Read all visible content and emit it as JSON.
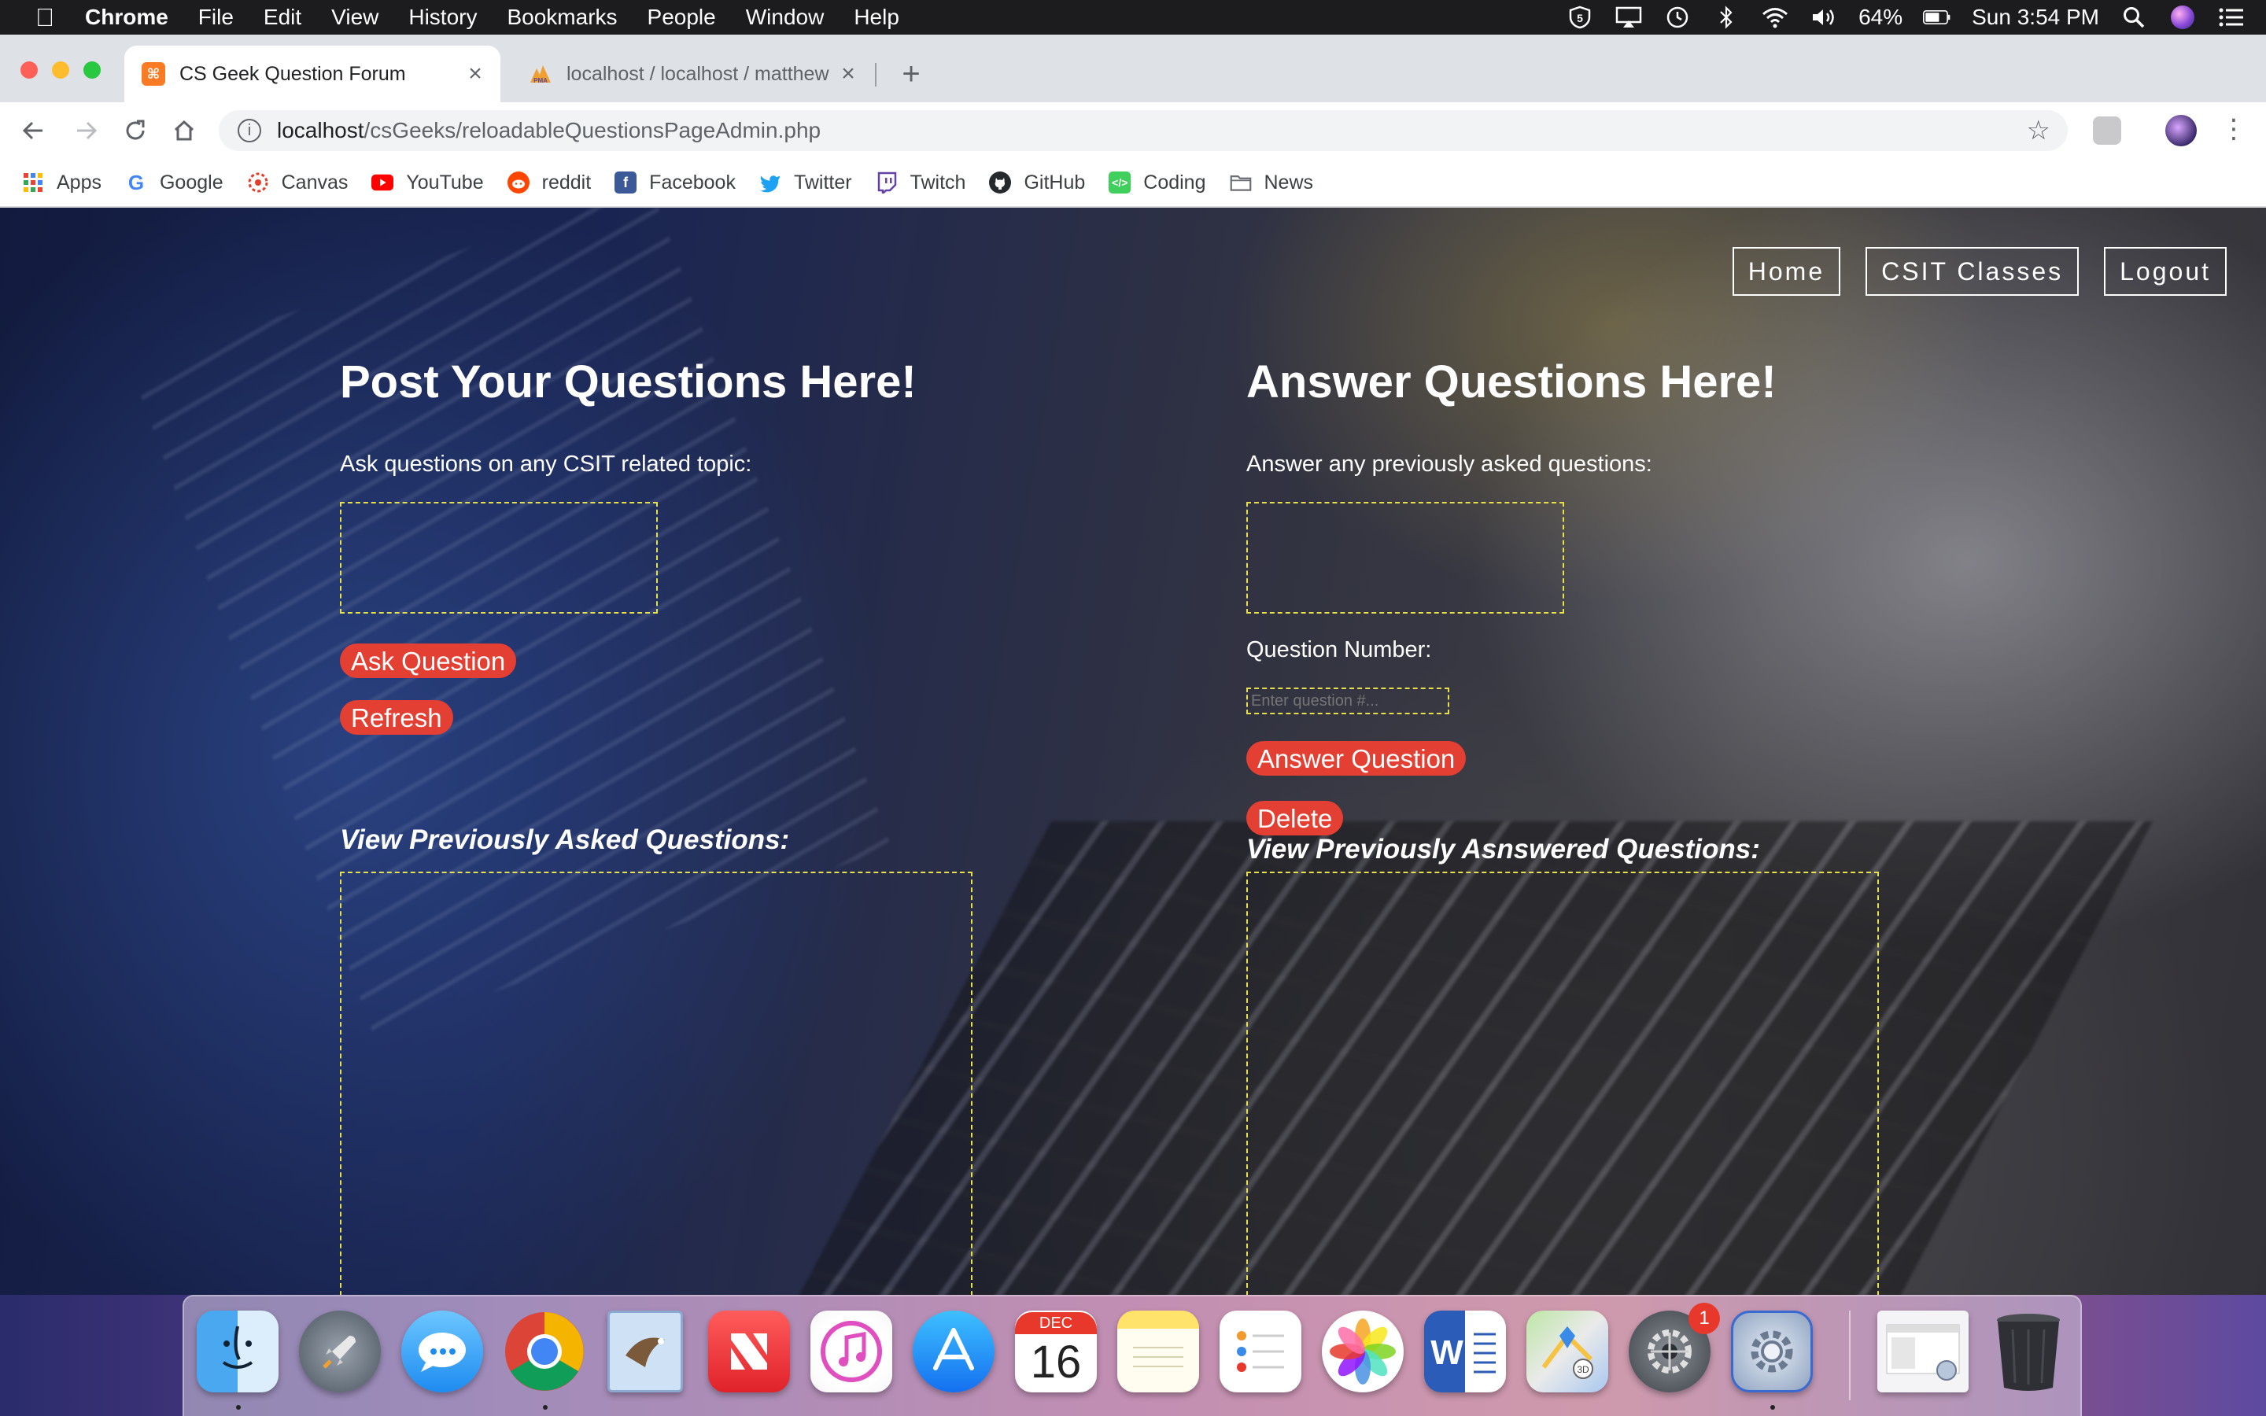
{
  "menubar": {
    "app": "Chrome",
    "items": [
      "File",
      "Edit",
      "View",
      "History",
      "Bookmarks",
      "People",
      "Window",
      "Help"
    ],
    "battery": "64%",
    "clock": "Sun 3:54 PM"
  },
  "tabs": [
    {
      "title": "CS Geek Question Forum",
      "favicon": "xampp-icon"
    },
    {
      "title": "localhost / localhost / matthew",
      "favicon": "phpmyadmin-icon"
    }
  ],
  "address": {
    "host": "localhost",
    "path": "/csGeeks/reloadableQuestionsPageAdmin.php"
  },
  "bookmarks": [
    {
      "label": "Apps",
      "icon": "apps-grid-icon",
      "color": "#4285f4"
    },
    {
      "label": "Google",
      "icon": "google-icon",
      "color": "#ffffff"
    },
    {
      "label": "Canvas",
      "icon": "canvas-icon",
      "color": "#e13f2b"
    },
    {
      "label": "YouTube",
      "icon": "youtube-icon",
      "color": "#ff0000"
    },
    {
      "label": "reddit",
      "icon": "reddit-icon",
      "color": "#ff4500"
    },
    {
      "label": "Facebook",
      "icon": "facebook-icon",
      "color": "#3b5998"
    },
    {
      "label": "Twitter",
      "icon": "twitter-icon",
      "color": "#1da1f2"
    },
    {
      "label": "Twitch",
      "icon": "twitch-icon",
      "color": "#6441a5"
    },
    {
      "label": "GitHub",
      "icon": "github-icon",
      "color": "#24292e"
    },
    {
      "label": "Coding",
      "icon": "coding-icon",
      "color": "#3ecf5c"
    },
    {
      "label": "News",
      "icon": "folder-icon",
      "color": "#6b6f75"
    }
  ],
  "nav": {
    "home": "Home",
    "classes": "CSIT Classes",
    "logout": "Logout"
  },
  "ask": {
    "heading": "Post Your Questions Here!",
    "subtitle": "Ask questions on any CSIT related topic:",
    "ask_button": "Ask Question",
    "refresh_button": "Refresh",
    "view_heading": "View Previously Asked Questions:"
  },
  "answer": {
    "heading": "Answer Questions Here!",
    "subtitle": "Answer any previously asked questions:",
    "question_number_label": "Question Number:",
    "question_number_placeholder": "Enter question #...",
    "answer_button": "Answer Question",
    "delete_button": "Delete",
    "view_heading": "View Previously Asnswered Questions:"
  },
  "dock": {
    "calendar_month": "DEC",
    "calendar_day": "16",
    "badge_count": "1"
  },
  "colors": {
    "accent_button": "#e33f33",
    "dashed_border": "#e8e04a"
  }
}
